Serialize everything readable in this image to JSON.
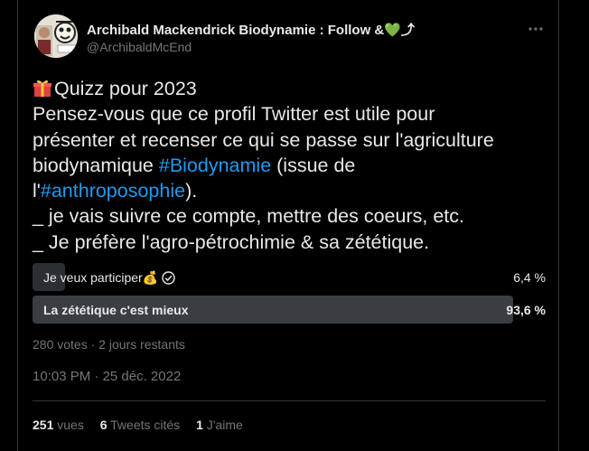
{
  "author": {
    "name": "Archibald Mackendrick Biodynamie : Follow &",
    "name_heart": "💚",
    "name_suffix": "⤴",
    "handle": "@ArchibaldMcEnd"
  },
  "tweet": {
    "line1": "Quizz pour 2023",
    "line2": "Pensez-vous que ce profil Twitter est utile pour",
    "line3": "présenter et recenser ce qui se passe sur l'agriculture",
    "line4_pre": "biodynamique ",
    "hashtag1": "#Biodynamie",
    "line4_post": " (issue de",
    "line5_pre": "l'",
    "hashtag2": "#anthroposophie",
    "line5_post": ").",
    "line6": "_ je vais suivre ce compte, mettre des coeurs, etc.",
    "line7": "_ Je préfère l'agro-pétrochimie & sa zététique."
  },
  "poll": {
    "options": [
      {
        "label": "Je veux participer",
        "label_emoji": "💰",
        "percent_text": "6,4 %",
        "fraction": 0.064,
        "voted": true
      },
      {
        "label": "La zététique c'est mieux",
        "percent_text": "93,6 %",
        "fraction": 0.936,
        "voted": false
      }
    ],
    "votes": "280 votes",
    "separator": " · ",
    "time_left": "2 jours restants"
  },
  "timestamp": {
    "time": "10:03 PM",
    "separator": " · ",
    "date": "25 déc. 2022"
  },
  "stats": {
    "views_count": "251",
    "views_label": "vues",
    "quotes_count": "6",
    "quotes_label": "Tweets cités",
    "likes_count": "1",
    "likes_label": "J'aime"
  },
  "colors": {
    "background": "#000000",
    "text": "#e7e9ea",
    "muted": "#71767b",
    "link": "#1d9bf0",
    "poll_winner": "#3a3d41",
    "poll_other": "#2b2e32",
    "border": "#2f3336"
  },
  "icons": {
    "more": "more-horizontal-icon",
    "gift": "gift-icon",
    "check": "check-circle-icon"
  }
}
